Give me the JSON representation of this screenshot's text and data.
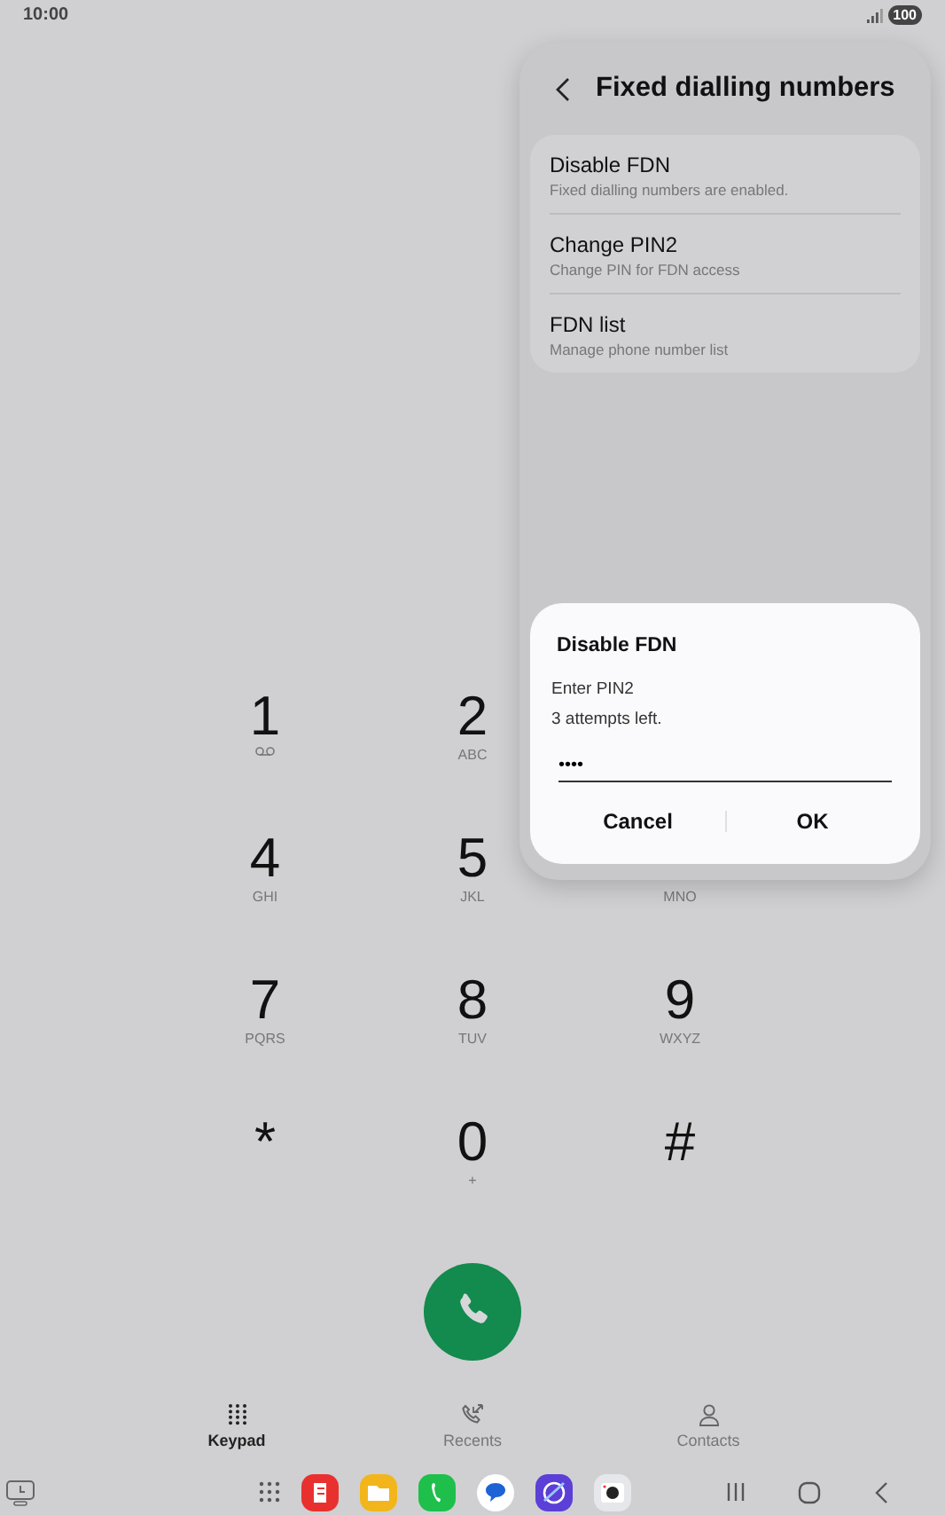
{
  "status_bar": {
    "time": "10:00",
    "battery": "100"
  },
  "keypad": {
    "rows": [
      [
        {
          "kind": "voicemail",
          "digit": "1"
        },
        {
          "kind": "standard",
          "digit": "2",
          "letters": "ABC"
        }
      ],
      [
        {
          "kind": "standard",
          "digit": "4",
          "letters": "GHI"
        },
        {
          "kind": "standard",
          "digit": "5",
          "letters": "JKL"
        },
        {
          "kind": "standard",
          "letters": "MNO"
        }
      ],
      [
        {
          "kind": "standard",
          "digit": "7",
          "letters": "PQRS"
        },
        {
          "kind": "standard",
          "digit": "8",
          "letters": "TUV"
        },
        {
          "kind": "standard",
          "digit": "9",
          "letters": "WXYZ"
        }
      ],
      [
        {
          "kind": "standard",
          "digit": "*"
        },
        {
          "kind": "standard",
          "digit": "0",
          "letters": "+"
        },
        {
          "kind": "standard",
          "digit": "#"
        }
      ]
    ]
  },
  "bottom_tabs": [
    {
      "label": "Keypad",
      "kind": "keypad",
      "selected": true
    },
    {
      "label": "Recents",
      "kind": "recents",
      "selected": false
    },
    {
      "label": "Contacts",
      "kind": "contacts",
      "selected": false
    }
  ],
  "taskbar": {
    "apps": [
      {
        "kind": "grid"
      },
      {
        "kind": "notes",
        "color": "#e8312f"
      },
      {
        "kind": "files",
        "color": "#f2b61c"
      },
      {
        "kind": "phone",
        "color": "#1fbf4c"
      },
      {
        "kind": "messages",
        "color": "#ffffff"
      },
      {
        "kind": "browser",
        "color": "#5b3fd6"
      },
      {
        "kind": "camera",
        "color": "#e6e7ea"
      }
    ]
  },
  "panel": {
    "title": "Fixed dialling numbers",
    "items": [
      {
        "title": "Disable FDN",
        "subtitle": "Fixed dialling numbers are enabled."
      },
      {
        "title": "Change PIN2",
        "subtitle": "Change PIN for FDN access"
      },
      {
        "title": "FDN list",
        "subtitle": "Manage phone number list"
      }
    ]
  },
  "dialog": {
    "title": "Disable FDN",
    "lines": [
      "Enter PIN2",
      "3 attempts left."
    ],
    "value": "••••",
    "buttons": [
      "Cancel",
      "OK"
    ]
  }
}
